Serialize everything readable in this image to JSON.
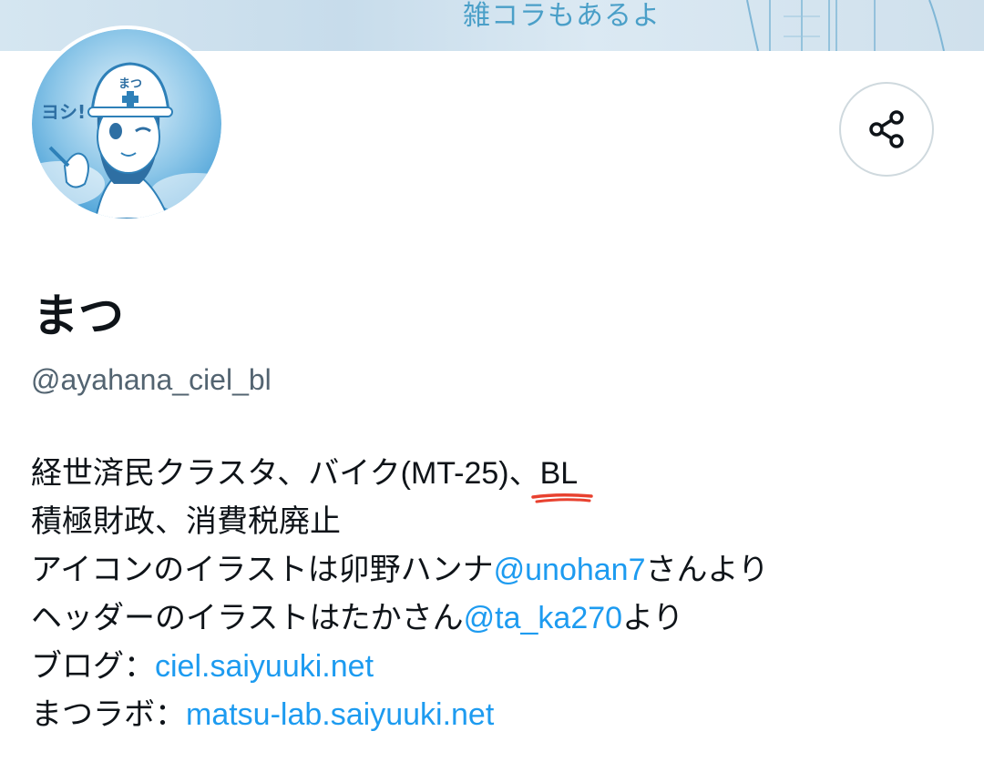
{
  "header": {
    "banner_text": "雑コラもあるよ"
  },
  "profile": {
    "display_name": "まつ",
    "handle": "@ayahana_ciel_bl",
    "avatar_text_badge": "ヨシ!",
    "avatar_helmet_text": "まつ"
  },
  "actions": {
    "share_icon": "share-icon"
  },
  "bio": {
    "line1_text": "経世済民クラスタ、バイク(MT-25)、",
    "line1_highlight": "BL",
    "line2_text": "積極財政、消費税廃止",
    "line3_prefix": "アイコンのイラストは卯野ハンナ",
    "line3_mention": "@unohan7",
    "line3_suffix": "さんより",
    "line4_prefix": "ヘッダーのイラストはたかさん",
    "line4_mention": "@ta_ka270",
    "line4_suffix": "より",
    "line5_label": "ブログ：",
    "line5_link": "ciel.saiyuuki.net",
    "line6_label": "まつラボ：",
    "line6_link": "matsu-lab.saiyuuki.net"
  },
  "colors": {
    "link": "#1d9bf0",
    "handle": "#536471",
    "text": "#0f1419",
    "underline_mark": "#e8412f",
    "border": "#cfd9de"
  }
}
